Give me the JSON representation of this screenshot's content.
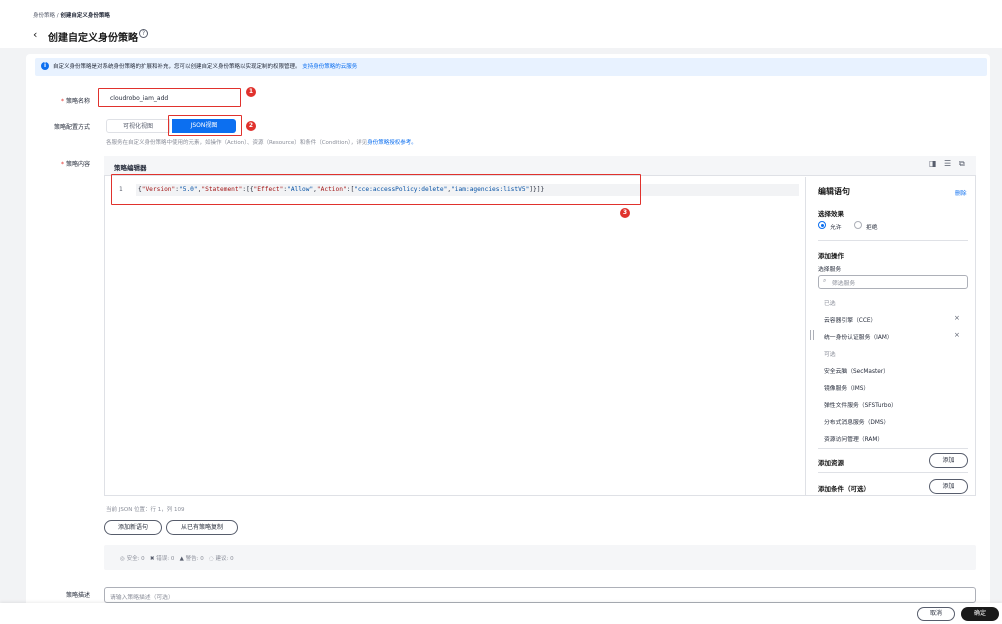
{
  "breadcrumb": {
    "root": "身份策略",
    "separator": " / ",
    "current": "创建自定义身份策略"
  },
  "page": {
    "title": "创建自定义身份策略",
    "help_icon": "help-circle-icon",
    "back_icon": "chevron-left-icon"
  },
  "info": {
    "text": "自定义身份策略是对系统身份策略的扩展和补充，您可以创建自定义身份策略以实现定制的权限管理。",
    "link": "支持身份策略的云服务"
  },
  "form": {
    "name_label": "策略名称",
    "name_value": "cloudrobo_iam_add",
    "mode_label": "策略配置方式",
    "mode_visual": "可视化视图",
    "mode_json": "JSON视图",
    "mode_hint": "各服务在自定义身份策略中使用的元素，如操作（Action）、资源（Resource）和条件（Condition），详见",
    "mode_hint_link": "身份策略授权参考。",
    "content_label": "策略内容",
    "desc_label": "策略描述",
    "desc_placeholder": "请输入策略描述（可选）"
  },
  "annotations": [
    "1",
    "2",
    "3"
  ],
  "editor": {
    "title": "策略编辑器",
    "line_number": "1",
    "code": "{\"Version\":\"5.0\",\"Statement\":[{\"Effect\":\"Allow\",\"Action\":[\"cce:accessPolicy:delete\",\"iam:agencies:listV5\"]}]}",
    "status": "当前 JSON 位置：行 1，列 109",
    "add_statement": "添加新语句",
    "copy_from": "从已有策略复制"
  },
  "panel": {
    "title": "编辑语句",
    "delete": "删除",
    "effect_label": "选择效果",
    "allow": "允许",
    "deny": "拒绝",
    "add_action": "添加操作",
    "select_service": "选择服务",
    "search_placeholder": "筛选服务",
    "selected_label": "已选",
    "selected": [
      "云容器引擎（CCE）",
      "统一身份认证服务（IAM）"
    ],
    "available_label": "可选",
    "available": [
      "安全云脑（SecMaster）",
      "镜像服务（IMS）",
      "弹性文件服务（SFSTurbo）",
      "分布式消息服务（DMS）",
      "资源访问管理（RAM）"
    ],
    "add_resource": "添加资源",
    "add_condition": "添加条件（可选）",
    "add_btn": "添加"
  },
  "stats": {
    "safe": "安全: 0",
    "error": "错误: 0",
    "warning": "警告: 0",
    "suggest": "建议: 0"
  },
  "footer": {
    "cancel": "取消",
    "ok": "确定"
  },
  "colors": {
    "accent": "#0c6ff0",
    "annotation": "#e0322d",
    "primary_button": "#191919"
  }
}
